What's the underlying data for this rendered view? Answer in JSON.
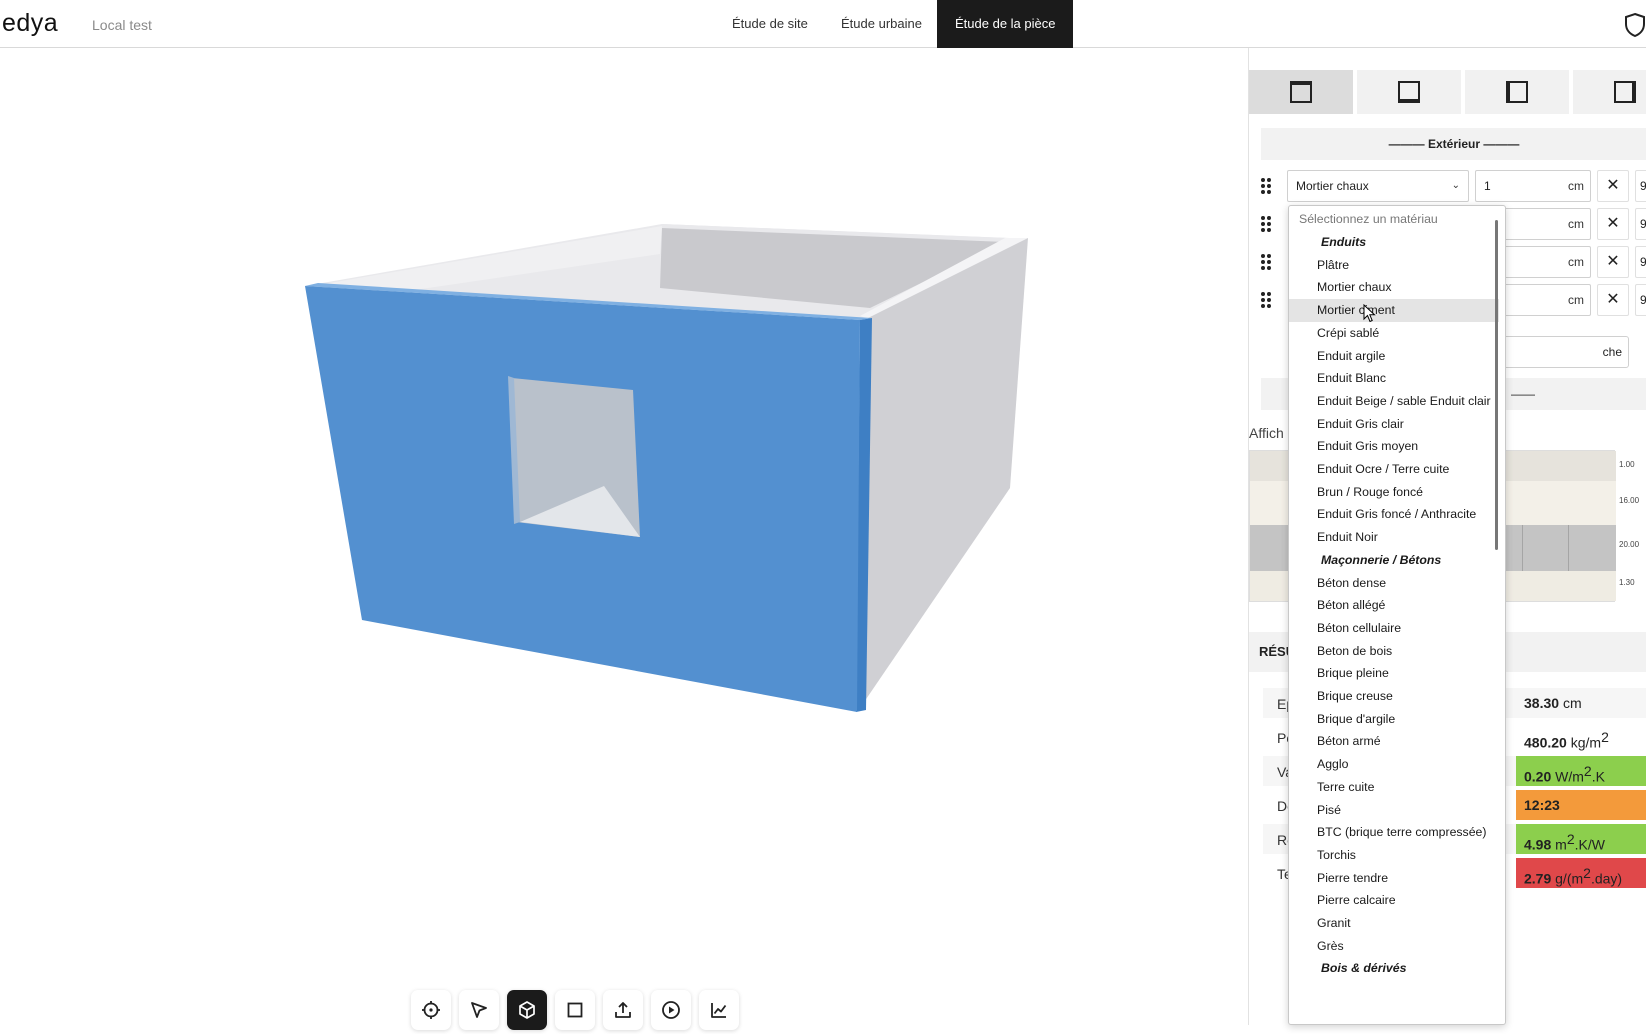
{
  "app": {
    "brand": "edya",
    "project": "Local test"
  },
  "nav": {
    "tabs": [
      {
        "label": "Étude de site",
        "active": false
      },
      {
        "label": "Étude urbaine",
        "active": false
      },
      {
        "label": "Étude de la pièce",
        "active": true
      }
    ],
    "shield_icon": "shield-icon"
  },
  "toolbar": {
    "tools": [
      {
        "icon": "crosshair-icon",
        "active": false
      },
      {
        "icon": "pointer-icon",
        "active": false
      },
      {
        "icon": "cube-icon",
        "active": true
      },
      {
        "icon": "square-icon",
        "active": false
      },
      {
        "icon": "upload-icon",
        "active": false
      },
      {
        "icon": "play-icon",
        "active": false
      },
      {
        "icon": "chart-line-icon",
        "active": false
      }
    ]
  },
  "panel": {
    "section_title": "——— Extérieur ———",
    "layers": [
      {
        "material": "Mortier chaux",
        "thickness": "1",
        "unit": "cm",
        "extra": "9"
      },
      {
        "material": "",
        "thickness": "",
        "unit": "cm",
        "extra": "9"
      },
      {
        "material": "",
        "thickness": "",
        "unit": "cm",
        "extra": "9"
      },
      {
        "material": "",
        "thickness": "",
        "unit": "cm",
        "extra": "9"
      }
    ],
    "add_label_fragment": "che",
    "section2_fragment": "——",
    "display_label_fragment": "Affich",
    "scale_labels": [
      "1.00",
      "16.00",
      "20.00",
      "1.30"
    ],
    "results_title_fragment": "RÉSU",
    "results": [
      {
        "label_fragment": "Ep",
        "value": "38.30",
        "unit": "cm",
        "unit_sup": "",
        "unit_tail": "",
        "color": ""
      },
      {
        "label_fragment": "Po",
        "value": "480.20",
        "unit": "kg/m",
        "unit_sup": "2",
        "unit_tail": "",
        "color": ""
      },
      {
        "label_fragment": "Va",
        "value": "0.20",
        "unit": "W/m",
        "unit_sup": "2",
        "unit_tail": ".K",
        "color": "#8ccf4d"
      },
      {
        "label_fragment": "De",
        "value": "12:23",
        "unit": "",
        "unit_sup": "",
        "unit_tail": "",
        "color": "#f39a3b"
      },
      {
        "label_fragment": "Re",
        "value": "4.98",
        "unit": "m",
        "unit_sup": "2",
        "unit_tail": ".K/W",
        "color": "#8ccf4d"
      },
      {
        "label_fragment": "Te",
        "value": "2.79",
        "unit": "g/(m",
        "unit_sup": "2",
        "unit_tail": ".day)",
        "color": "#e0484a"
      }
    ]
  },
  "dropdown": {
    "placeholder": "Sélectionnez un matériau",
    "items": [
      {
        "label": "Enduits",
        "group": true
      },
      {
        "label": "Plâtre"
      },
      {
        "label": "Mortier chaux"
      },
      {
        "label": "Mortier ciment",
        "hover": true
      },
      {
        "label": "Crépi sablé"
      },
      {
        "label": "Enduit argile"
      },
      {
        "label": "Enduit Blanc"
      },
      {
        "label": "Enduit Beige / sable Enduit clair"
      },
      {
        "label": "Enduit Gris clair"
      },
      {
        "label": "Enduit Gris moyen"
      },
      {
        "label": "Enduit Ocre / Terre cuite"
      },
      {
        "label": "Brun / Rouge foncé"
      },
      {
        "label": "Enduit Gris foncé / Anthracite"
      },
      {
        "label": "Enduit Noir"
      },
      {
        "label": "Maçonnerie / Bétons",
        "group": true
      },
      {
        "label": "Béton dense"
      },
      {
        "label": "Béton allégé"
      },
      {
        "label": "Béton cellulaire"
      },
      {
        "label": "Beton de bois"
      },
      {
        "label": "Brique pleine"
      },
      {
        "label": "Brique creuse"
      },
      {
        "label": "Brique d'argile"
      },
      {
        "label": "Béton armé"
      },
      {
        "label": "Agglo"
      },
      {
        "label": "Terre cuite"
      },
      {
        "label": "Pisé"
      },
      {
        "label": "BTC (brique terre compressée)"
      },
      {
        "label": "Torchis"
      },
      {
        "label": "Pierre tendre"
      },
      {
        "label": "Pierre calcaire"
      },
      {
        "label": "Granit"
      },
      {
        "label": "Grès"
      },
      {
        "label": "Bois & dérivés",
        "group": true
      }
    ]
  },
  "colors": {
    "wall_selected": "#5390d0",
    "wall_gray": "#d2d2d6",
    "accent_dark": "#1b1b1b"
  }
}
